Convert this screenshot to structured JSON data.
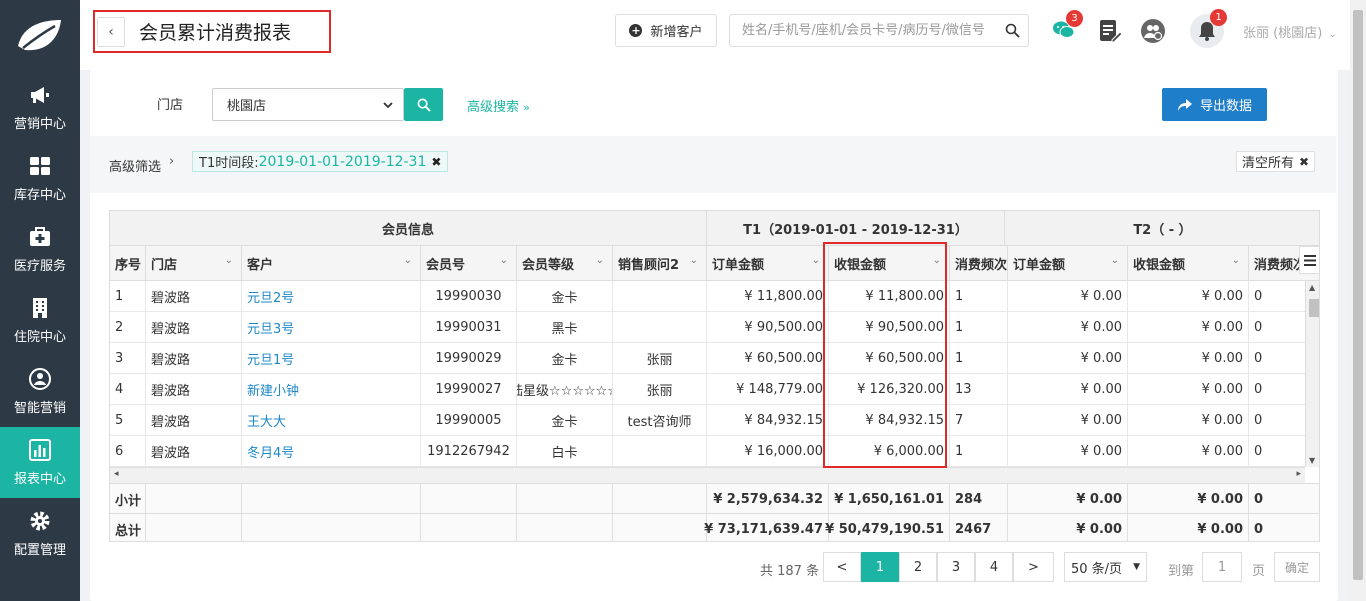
{
  "sidebar": {
    "items": [
      {
        "label": "营销中心",
        "icon": "megaphone-icon"
      },
      {
        "label": "库存中心",
        "icon": "grid-icon"
      },
      {
        "label": "医疗服务",
        "icon": "medkit-icon"
      },
      {
        "label": "住院中心",
        "icon": "building-icon"
      },
      {
        "label": "智能营销",
        "icon": "people-icon"
      },
      {
        "label": "报表中心",
        "icon": "bar-chart-icon",
        "active": true
      },
      {
        "label": "配置管理",
        "icon": "gear-icon"
      }
    ]
  },
  "header": {
    "title": "会员累计消费报表",
    "add_customer": "新增客户",
    "search_placeholder": "姓名/手机号/座机/会员卡号/病历号/微信号",
    "wechat_badge": "3",
    "bell_badge": "1",
    "user": "张丽 (桃園店)"
  },
  "filters": {
    "store_label": "门店",
    "store_value": "桃園店",
    "advanced_search": "高级搜索",
    "export": "导出数据",
    "adv_filter_label": "高级筛选",
    "tag_prefix": "T1时间段:",
    "tag_value": "2019-01-01-2019-12-31",
    "clear_all": "清空所有"
  },
  "table": {
    "groups": [
      "会员信息",
      "T1（2019-01-01 - 2019-12-31）",
      "T2（ - ）"
    ],
    "columns": [
      "序号",
      "门店",
      "客户",
      "会员号",
      "会员等级",
      "销售顾问2",
      "订单金额",
      "收银金额",
      "消费频次",
      "订单金额",
      "收银金额",
      "消费频次"
    ],
    "rows": [
      {
        "no": "1",
        "store": "碧波路",
        "customer": "元旦2号",
        "member_no": "19990030",
        "level": "金卡",
        "advisor": "",
        "t1_order": "¥ 11,800.00",
        "t1_cash": "¥ 11,800.00",
        "t1_freq": "1",
        "t2_order": "¥ 0.00",
        "t2_cash": "¥ 0.00",
        "t2_freq": "0"
      },
      {
        "no": "2",
        "store": "碧波路",
        "customer": "元旦3号",
        "member_no": "19990031",
        "level": "黑卡",
        "advisor": "",
        "t1_order": "¥ 90,500.00",
        "t1_cash": "¥ 90,500.00",
        "t1_freq": "1",
        "t2_order": "¥ 0.00",
        "t2_cash": "¥ 0.00",
        "t2_freq": "0"
      },
      {
        "no": "3",
        "store": "碧波路",
        "customer": "元旦1号",
        "member_no": "19990029",
        "level": "金卡",
        "advisor": "张丽",
        "t1_order": "¥ 60,500.00",
        "t1_cash": "¥ 60,500.00",
        "t1_freq": "1",
        "t2_order": "¥ 0.00",
        "t2_cash": "¥ 0.00",
        "t2_freq": "0"
      },
      {
        "no": "4",
        "store": "碧波路",
        "customer": "新建小钟",
        "member_no": "19990027",
        "level": "陆星级☆☆☆☆☆☆",
        "advisor": "张丽",
        "t1_order": "¥ 148,779.00",
        "t1_cash": "¥ 126,320.00",
        "t1_freq": "13",
        "t2_order": "¥ 0.00",
        "t2_cash": "¥ 0.00",
        "t2_freq": "0"
      },
      {
        "no": "5",
        "store": "碧波路",
        "customer": "王大大",
        "member_no": "19990005",
        "level": "金卡",
        "advisor": "test咨询师",
        "t1_order": "¥ 84,932.15",
        "t1_cash": "¥ 84,932.15",
        "t1_freq": "7",
        "t2_order": "¥ 0.00",
        "t2_cash": "¥ 0.00",
        "t2_freq": "0"
      },
      {
        "no": "6",
        "store": "碧波路",
        "customer": "冬月4号",
        "member_no": "1912267942",
        "level": "白卡",
        "advisor": "",
        "t1_order": "¥ 16,000.00",
        "t1_cash": "¥ 6,000.00",
        "t1_freq": "1",
        "t2_order": "¥ 0.00",
        "t2_cash": "¥ 0.00",
        "t2_freq": "0"
      }
    ],
    "subtotal": {
      "label": "小计",
      "t1_order": "¥ 2,579,634.32",
      "t1_cash": "¥ 1,650,161.01",
      "t1_freq": "284",
      "t2_order": "¥ 0.00",
      "t2_cash": "¥ 0.00",
      "t2_freq": "0"
    },
    "total": {
      "label": "总计",
      "t1_order": "¥ 73,171,639.47",
      "t1_cash": "¥ 50,479,190.51",
      "t1_freq": "2467",
      "t2_order": "¥ 0.00",
      "t2_cash": "¥ 0.00",
      "t2_freq": "0"
    }
  },
  "pagination": {
    "total_text": "共 187 条",
    "prev": "<",
    "pages": [
      "1",
      "2",
      "3",
      "4"
    ],
    "next": ">",
    "page_size": "50 条/页",
    "goto_label": "到第",
    "goto_value": "1",
    "page_unit": "页",
    "confirm": "确定"
  },
  "colors": {
    "accent": "#1cb5a4",
    "sidebar": "#2d3945",
    "link": "#1e88c7",
    "export": "#1f7ec9",
    "highlight": "#e02a2a"
  }
}
